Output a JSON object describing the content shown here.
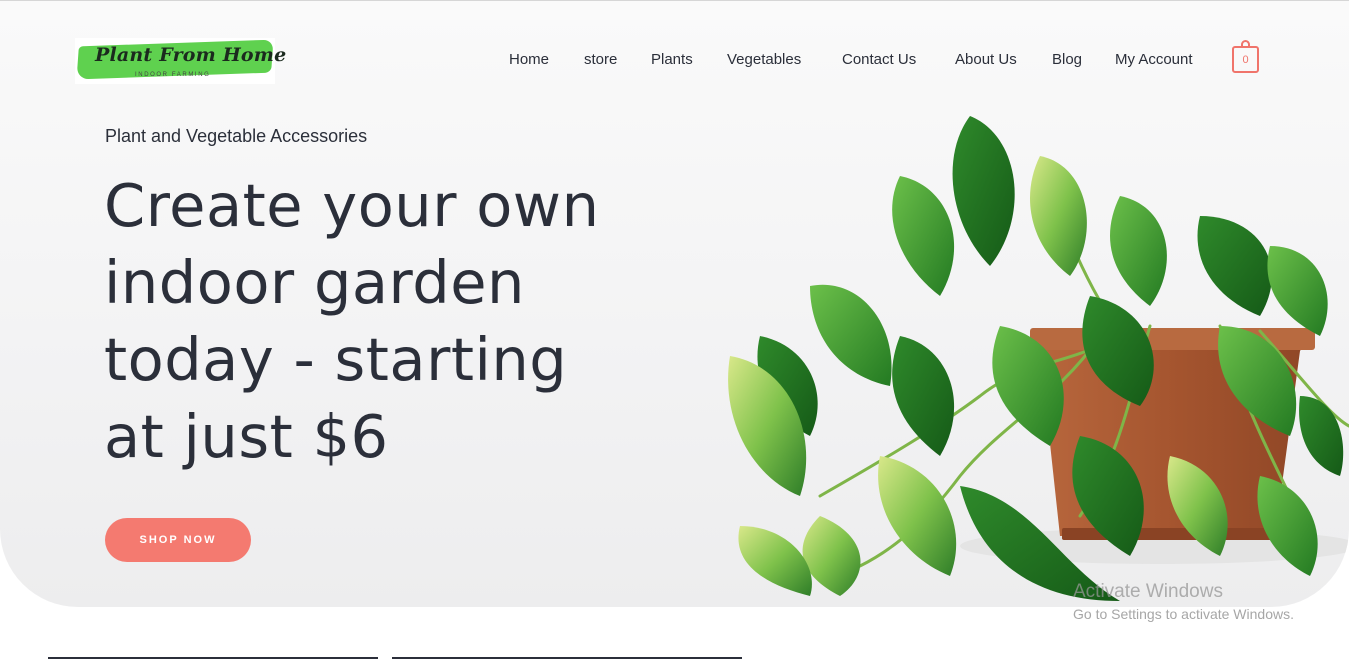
{
  "brand": {
    "logo_title": "Plant From Home",
    "logo_subtitle": "INDOOR FARMING"
  },
  "nav": {
    "items": [
      {
        "label": "Home"
      },
      {
        "label": "store"
      },
      {
        "label": "Plants"
      },
      {
        "label": "Vegetables"
      },
      {
        "label": "Contact Us"
      },
      {
        "label": "About Us"
      },
      {
        "label": "Blog"
      },
      {
        "label": "My Account"
      }
    ],
    "cart_count": "0",
    "cart_icon": "shopping-bag-icon"
  },
  "hero": {
    "eyebrow": "Plant and Vegetable Accessories",
    "headline_lines": [
      "Create your own",
      "indoor garden",
      "today - starting",
      "at just $6"
    ],
    "cta_label": "SHOP NOW",
    "image": "potted-pothos-plant"
  },
  "watermark": {
    "title": "Activate Windows",
    "subtitle": "Go to Settings to activate Windows."
  },
  "colors": {
    "accent": "#f47a70",
    "text": "#2b2f3a",
    "logo_green": "#5fd14f",
    "pot": "#a95a35",
    "leaf": "#2f7d2a"
  }
}
